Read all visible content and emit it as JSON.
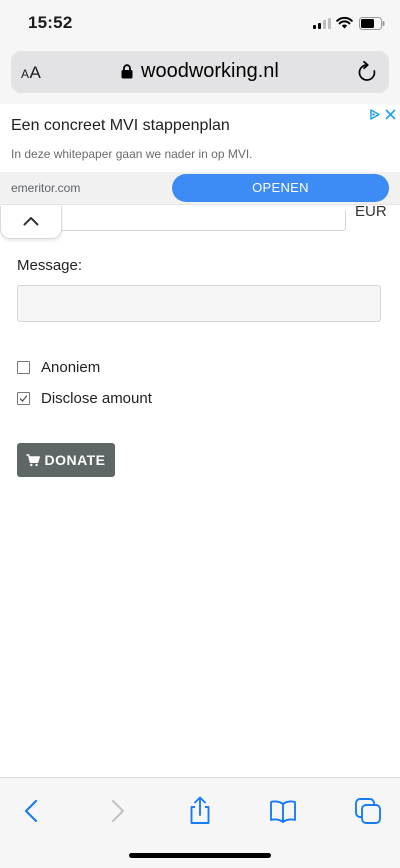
{
  "status_bar": {
    "time": "15:52"
  },
  "browser": {
    "text_size_label": "AA",
    "url": "woodworking.nl"
  },
  "ad": {
    "title": "Een concreet MVI stappenplan",
    "description": "In deze whitepaper gaan we nader in op MVI.",
    "domain": "emeritor.com",
    "cta": "OPENEN",
    "cta_color": "#3d8bf5"
  },
  "form": {
    "currency": "EUR",
    "message_label": "Message:",
    "message_value": "",
    "checkboxes": [
      {
        "label": "Anoniem",
        "checked": false
      },
      {
        "label": "Disclose amount",
        "checked": true
      }
    ],
    "donate_label": "DONATE",
    "donate_color": "#5f6766"
  },
  "toolbar": {
    "icons": [
      "back-icon",
      "forward-icon",
      "share-icon",
      "bookmarks-icon",
      "tabs-icon"
    ],
    "accent": "#1a7cf5"
  }
}
